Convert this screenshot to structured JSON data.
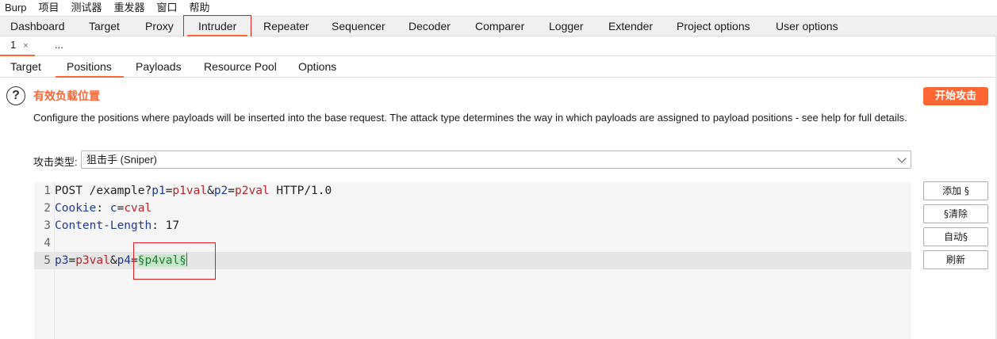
{
  "menubar": [
    "Burp",
    "项目",
    "测试器",
    "重发器",
    "窗口",
    "帮助"
  ],
  "top_tabs": [
    {
      "label": "Dashboard",
      "active": false
    },
    {
      "label": "Target",
      "active": false
    },
    {
      "label": "Proxy",
      "active": false
    },
    {
      "label": "Intruder",
      "active": true
    },
    {
      "label": "Repeater",
      "active": false
    },
    {
      "label": "Sequencer",
      "active": false
    },
    {
      "label": "Decoder",
      "active": false
    },
    {
      "label": "Comparer",
      "active": false
    },
    {
      "label": "Logger",
      "active": false
    },
    {
      "label": "Extender",
      "active": false
    },
    {
      "label": "Project options",
      "active": false
    },
    {
      "label": "User options",
      "active": false
    }
  ],
  "attack_tabs": [
    {
      "label": "1",
      "close": "×",
      "active": true
    },
    {
      "label": "...",
      "close": "",
      "active": false
    }
  ],
  "inner_tabs": [
    {
      "label": "Target",
      "active": false
    },
    {
      "label": "Positions",
      "active": true
    },
    {
      "label": "Payloads",
      "active": false
    },
    {
      "label": "Resource Pool",
      "active": false
    },
    {
      "label": "Options",
      "active": false
    }
  ],
  "section": {
    "help_icon": "?",
    "title": "有效负载位置",
    "description": "Configure the positions where payloads will be inserted into the base request. The attack type determines the way in which payloads are assigned to payload positions - see help for full details.",
    "start_attack": "开始攻击"
  },
  "attack_type": {
    "label": "攻击类型:",
    "value": "狙击手 (Sniper)"
  },
  "request_lines": [
    {
      "num": "1",
      "highlight": false,
      "segments": [
        {
          "text": "POST /example?",
          "type": "plain"
        },
        {
          "text": "p1",
          "type": "blue"
        },
        {
          "text": "=",
          "type": "plain"
        },
        {
          "text": "p1val",
          "type": "red"
        },
        {
          "text": "&",
          "type": "plain"
        },
        {
          "text": "p2",
          "type": "blue"
        },
        {
          "text": "=",
          "type": "plain"
        },
        {
          "text": "p2val",
          "type": "red"
        },
        {
          "text": " HTTP/1.0",
          "type": "plain"
        }
      ]
    },
    {
      "num": "2",
      "highlight": false,
      "segments": [
        {
          "text": "Cookie",
          "type": "blue"
        },
        {
          "text": ": ",
          "type": "plain"
        },
        {
          "text": "c",
          "type": "blue"
        },
        {
          "text": "=",
          "type": "plain"
        },
        {
          "text": "cval",
          "type": "red"
        }
      ]
    },
    {
      "num": "3",
      "highlight": false,
      "segments": [
        {
          "text": "Content-Length",
          "type": "blue"
        },
        {
          "text": ": 17",
          "type": "plain"
        }
      ]
    },
    {
      "num": "4",
      "highlight": false,
      "segments": []
    },
    {
      "num": "5",
      "highlight": true,
      "segments": [
        {
          "text": "p3",
          "type": "blue"
        },
        {
          "text": "=",
          "type": "plain"
        },
        {
          "text": "p3val",
          "type": "red"
        },
        {
          "text": "&",
          "type": "plain"
        },
        {
          "text": "p4",
          "type": "blue"
        },
        {
          "text": "=",
          "type": "plain"
        },
        {
          "text": "§p4val§",
          "type": "payload"
        }
      ]
    }
  ],
  "side_buttons": [
    "添加 §",
    "§清除",
    "自动§",
    "刷新"
  ],
  "colors": {
    "accent": "#ff6633",
    "annotation_box": "#e02020",
    "key_blue": "#1f3a93",
    "value_red": "#b5242a",
    "payload_green": "#1e7a3a"
  }
}
